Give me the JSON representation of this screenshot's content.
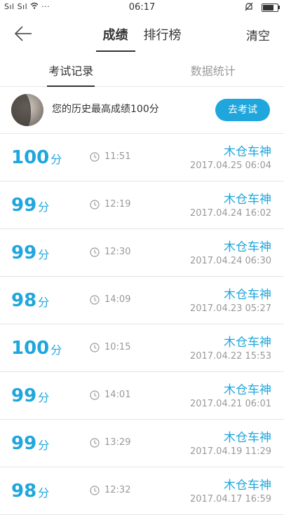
{
  "status_bar": {
    "signal": "Sıl Sıl",
    "dots": "···",
    "time": "06:17"
  },
  "header": {
    "tabs": [
      {
        "label": "成绩"
      },
      {
        "label": "排行榜"
      }
    ],
    "clear_label": "清空"
  },
  "subtabs": [
    {
      "label": "考试记录"
    },
    {
      "label": "数据统计"
    }
  ],
  "best": {
    "text": "您的历史最高成绩100分",
    "button_label": "去考试"
  },
  "records": [
    {
      "score": "100",
      "unit": "分",
      "duration": "11:51",
      "name": "木仓车神",
      "date": "2017.04.25  06:04"
    },
    {
      "score": "99",
      "unit": "分",
      "duration": "12:19",
      "name": "木仓车神",
      "date": "2017.04.24  16:02"
    },
    {
      "score": "99",
      "unit": "分",
      "duration": "12:30",
      "name": "木仓车神",
      "date": "2017.04.24  06:30"
    },
    {
      "score": "98",
      "unit": "分",
      "duration": "14:09",
      "name": "木仓车神",
      "date": "2017.04.23  05:27"
    },
    {
      "score": "100",
      "unit": "分",
      "duration": "10:15",
      "name": "木仓车神",
      "date": "2017.04.22  15:53"
    },
    {
      "score": "99",
      "unit": "分",
      "duration": "14:01",
      "name": "木仓车神",
      "date": "2017.04.21  06:01"
    },
    {
      "score": "99",
      "unit": "分",
      "duration": "13:29",
      "name": "木仓车神",
      "date": "2017.04.19  11:29"
    },
    {
      "score": "98",
      "unit": "分",
      "duration": "12:32",
      "name": "木仓车神",
      "date": "2017.04.17  16:59"
    }
  ],
  "colors": {
    "accent": "#1fa6dd",
    "muted": "#999999",
    "divider": "#e5e5e5"
  }
}
